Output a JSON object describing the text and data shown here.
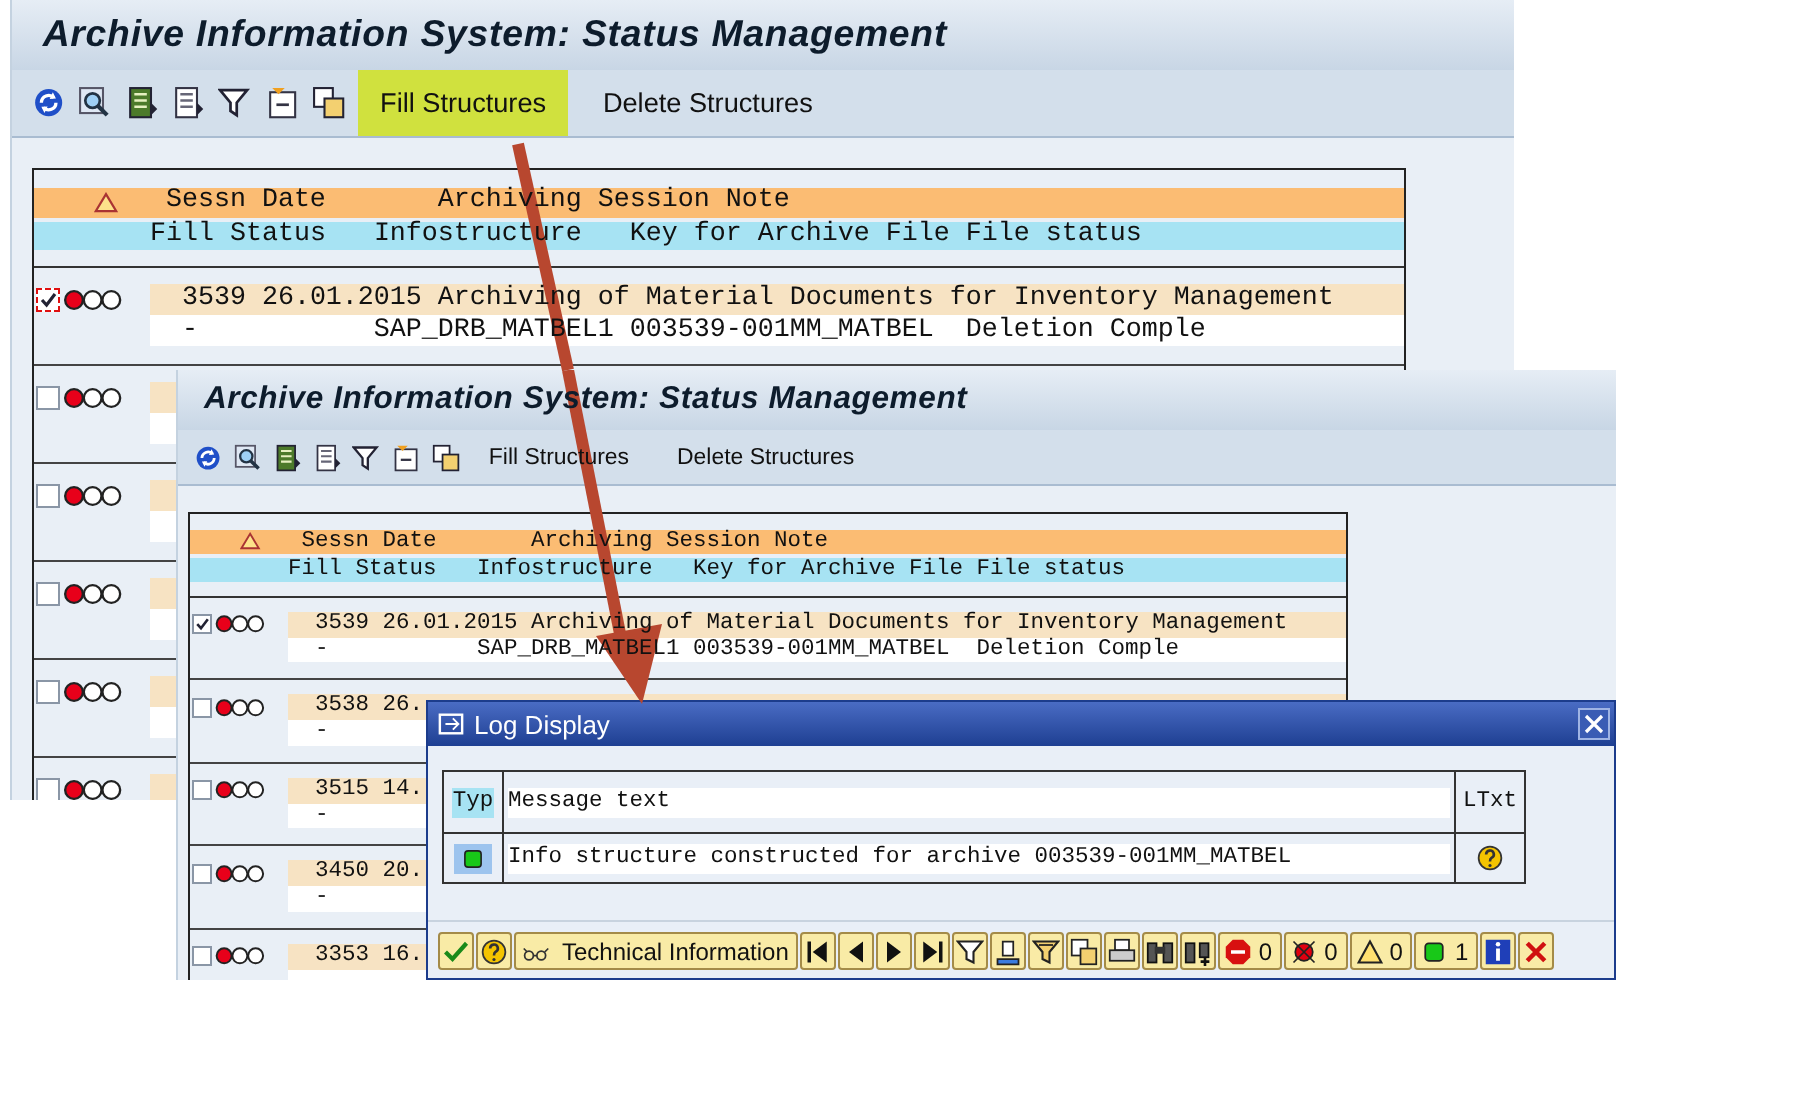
{
  "back_window": {
    "title": "Archive Information System: Status Management",
    "toolbar_buttons": [
      {
        "label": "Fill Structures",
        "highlighted": true
      },
      {
        "label": "Delete Structures",
        "highlighted": false
      }
    ],
    "table": {
      "header_1": [
        "Sessn Date",
        "Archiving Session Note"
      ],
      "header_2": [
        "Fill Status",
        "Infostructure",
        "Key for Archive File",
        "File status"
      ],
      "rows": [
        {
          "checked": true,
          "focused": true,
          "kind": "error",
          "line_1": "3539 26.01.2015 Archiving of Material Documents for Inventory Management",
          "line_2": [
            "-",
            "SAP_DRB_MATBEL1",
            "003539-001MM_MATBEL",
            "Deletion Comple"
          ]
        },
        {
          "checked": false,
          "focused": false,
          "kind": "error"
        },
        {
          "checked": false,
          "focused": false,
          "kind": "error"
        },
        {
          "checked": false,
          "focused": false,
          "kind": "error"
        },
        {
          "checked": false,
          "focused": false,
          "kind": "error"
        },
        {
          "checked": false,
          "focused": false,
          "kind": "error"
        }
      ]
    }
  },
  "front_window": {
    "title": "Archive Information System: Status Management",
    "toolbar_buttons": [
      {
        "label": "Fill Structures",
        "highlighted": false
      },
      {
        "label": "Delete Structures",
        "highlighted": false
      }
    ],
    "table": {
      "header_1": [
        "Sessn Date",
        "Archiving Session Note"
      ],
      "header_2": [
        "Fill Status",
        "Infostructure",
        "Key for Archive File",
        "File status"
      ],
      "rows": [
        {
          "checked": true,
          "kind": "error",
          "line_1": "3539 26.01.2015 Archiving of Material Documents for Inventory Management",
          "line_2": [
            "-",
            "SAP_DRB_MATBEL1",
            "003539-001MM_MATBEL",
            "Deletion Comple"
          ]
        },
        {
          "checked": false,
          "kind": "error",
          "line_1": "3538 26.",
          "line_2": [
            "-"
          ]
        },
        {
          "checked": false,
          "kind": "error",
          "line_1": "3515 14.",
          "line_2": [
            "-"
          ]
        },
        {
          "checked": false,
          "kind": "error",
          "line_1": "3450 20.",
          "line_2": [
            "-"
          ]
        },
        {
          "checked": false,
          "kind": "error",
          "line_1": "3353 16."
        }
      ]
    }
  },
  "dialog": {
    "title": "Log Display",
    "columns": [
      "Typ",
      "Message text",
      "LTxt"
    ],
    "messages": [
      {
        "kind": "success",
        "text": "Info structure constructed for archive 003539-001MM_MATBEL"
      }
    ],
    "technical_button": "Technical Information",
    "counters": [
      {
        "kind": "stop",
        "count": "0"
      },
      {
        "kind": "error",
        "count": "0"
      },
      {
        "kind": "warning",
        "count": "0"
      },
      {
        "kind": "success",
        "count": "1"
      }
    ]
  }
}
